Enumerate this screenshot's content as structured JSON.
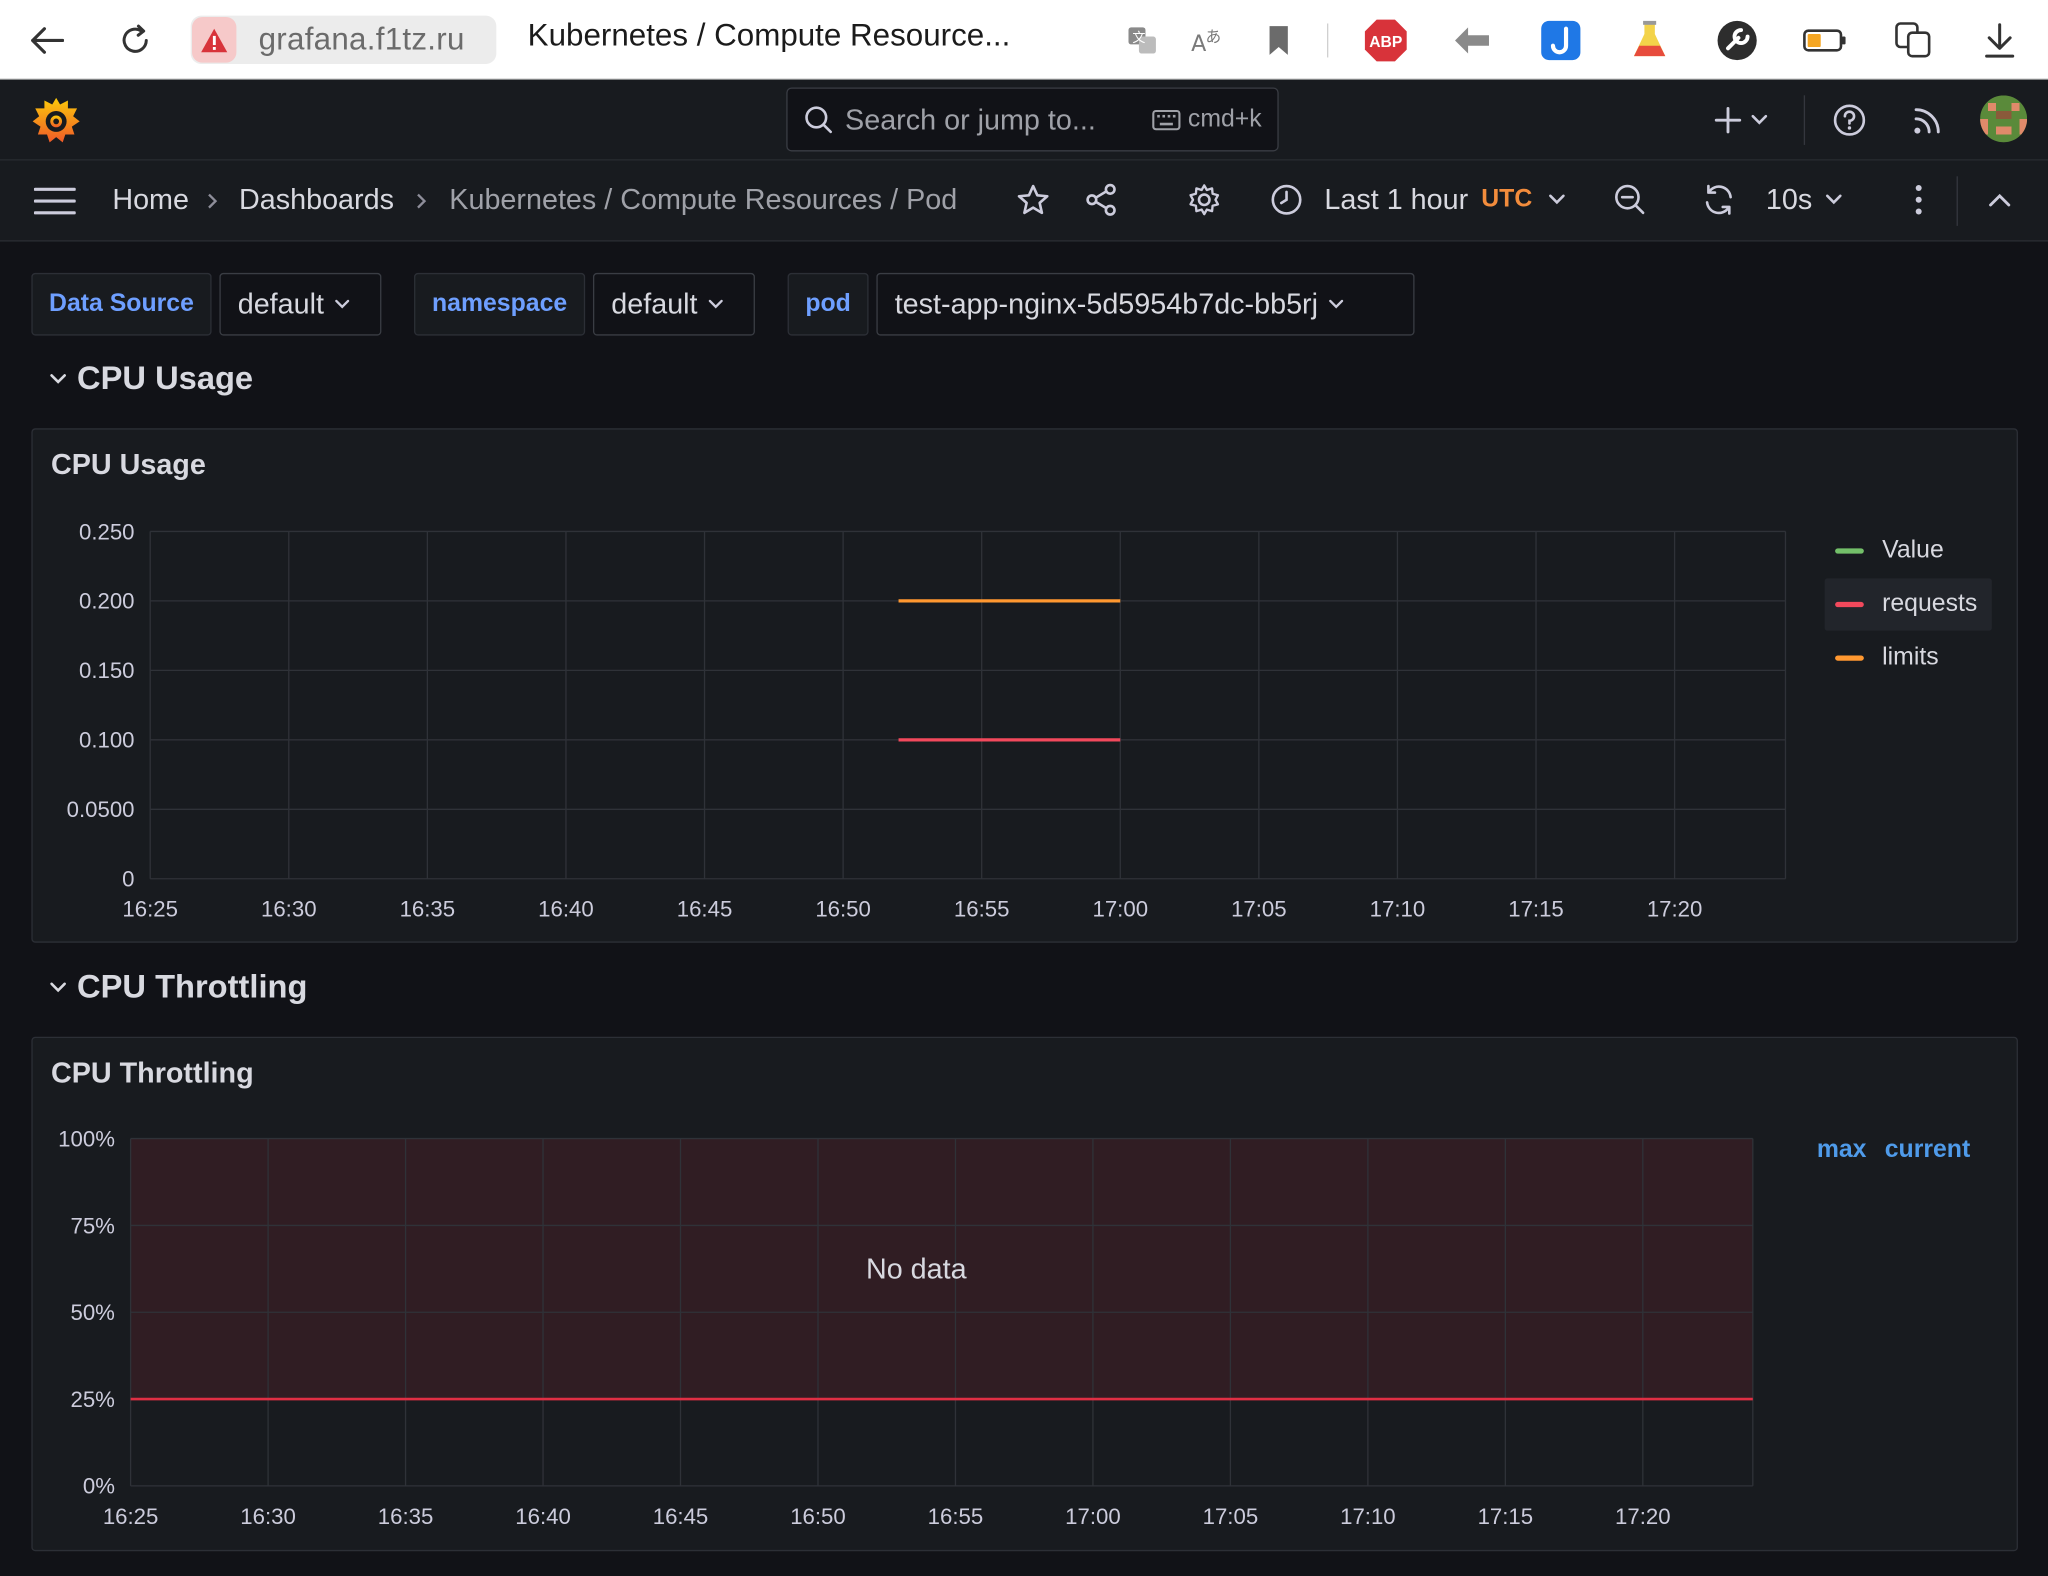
{
  "browser": {
    "url": "grafana.f1tz.ru",
    "tab_title": "Kubernetes / Compute Resource...",
    "abp_label": "ABP"
  },
  "topnav": {
    "search_placeholder": "Search or jump to...",
    "search_shortcut": "cmd+k"
  },
  "breadcrumb": {
    "home": "Home",
    "dashboards": "Dashboards",
    "current": "Kubernetes / Compute Resources / Pod"
  },
  "toolbar": {
    "time_range": "Last 1 hour",
    "timezone": "UTC",
    "refresh_interval": "10s"
  },
  "variables": {
    "datasource_label": "Data Source",
    "datasource_value": "default",
    "namespace_label": "namespace",
    "namespace_value": "default",
    "pod_label": "pod",
    "pod_value": "test-app-nginx-5d5954b7dc-bb5rj"
  },
  "rows": {
    "cpu_usage": "CPU Usage",
    "cpu_throttling": "CPU Throttling"
  },
  "colors": {
    "accent_blue": "#6e9fff",
    "timezone_orange": "#f28c3c",
    "series_value": "#73bf69",
    "series_requests": "#f2495c",
    "series_limits": "#ff9830",
    "threshold_red": "#e02f44"
  },
  "chart_data": [
    {
      "type": "line",
      "title": "CPU Usage",
      "x_ticks": [
        "16:25",
        "16:30",
        "16:35",
        "16:40",
        "16:45",
        "16:50",
        "16:55",
        "17:00",
        "17:05",
        "17:10",
        "17:15",
        "17:20"
      ],
      "y_ticks": [
        "0",
        "0.0500",
        "0.100",
        "0.150",
        "0.200",
        "0.250"
      ],
      "ylim": [
        0,
        0.25
      ],
      "xlim": [
        "16:25",
        "17:24"
      ],
      "grid": true,
      "legend_position": "right",
      "series": [
        {
          "name": "Value",
          "color": "#73bf69",
          "x": [],
          "y": []
        },
        {
          "name": "requests",
          "color": "#f2495c",
          "x": [
            "16:52",
            "17:00"
          ],
          "y": [
            0.1,
            0.1
          ]
        },
        {
          "name": "limits",
          "color": "#ff9830",
          "x": [
            "16:52",
            "17:00"
          ],
          "y": [
            0.2,
            0.2
          ]
        }
      ]
    },
    {
      "type": "line",
      "title": "CPU Throttling",
      "x_ticks": [
        "16:25",
        "16:30",
        "16:35",
        "16:40",
        "16:45",
        "16:50",
        "16:55",
        "17:00",
        "17:05",
        "17:10",
        "17:15",
        "17:20"
      ],
      "y_ticks": [
        "0%",
        "25%",
        "50%",
        "75%",
        "100%"
      ],
      "ylim": [
        0,
        100
      ],
      "xlim": [
        "16:25",
        "17:24"
      ],
      "grid": true,
      "legend_position": "right",
      "legend_columns": [
        "max",
        "current"
      ],
      "threshold": 25,
      "no_data_text": "No data",
      "series": []
    }
  ]
}
